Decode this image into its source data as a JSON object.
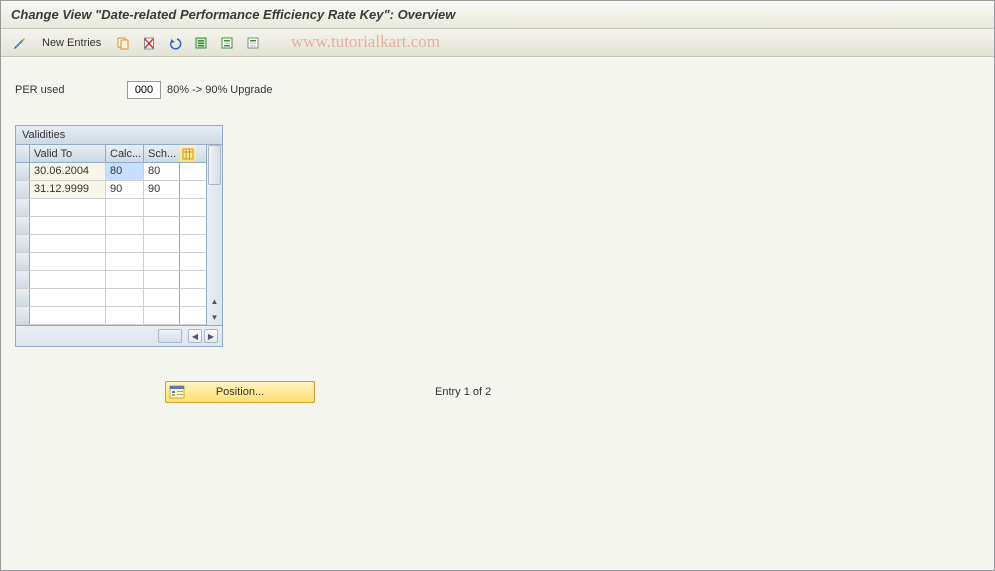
{
  "header": {
    "title": "Change View \"Date-related Performance Efficiency Rate Key\": Overview"
  },
  "toolbar": {
    "new_entries_label": "New Entries",
    "watermark": "www.tutorialkart.com"
  },
  "field": {
    "label": "PER used",
    "value": "000",
    "description": "80% -> 90% Upgrade"
  },
  "table": {
    "title": "Validities",
    "columns": {
      "valid_to": "Valid To",
      "calc": "Calc...",
      "sch": "Sch..."
    },
    "rows": [
      {
        "valid_to": "30.06.2004",
        "calc": "80",
        "sch": "80",
        "selected": true
      },
      {
        "valid_to": "31.12.9999",
        "calc": "90",
        "sch": "90",
        "selected": false
      }
    ]
  },
  "footer": {
    "position_label": "Position...",
    "entry_text": "Entry 1 of 2"
  }
}
